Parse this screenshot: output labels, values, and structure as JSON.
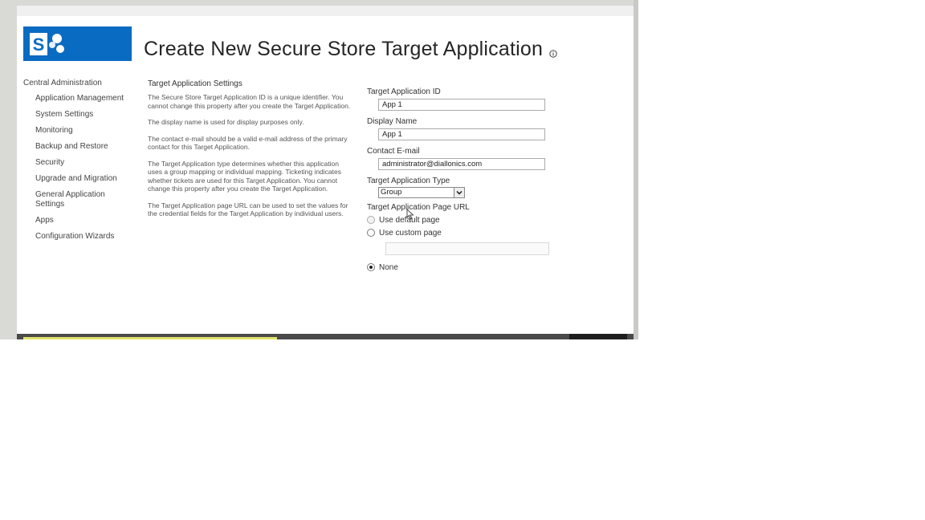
{
  "header": {
    "title": "Create New Secure Store Target Application"
  },
  "icons": {
    "logo": "sharepoint-logo",
    "info": "info-icon"
  },
  "nav": {
    "root": "Central Administration",
    "items": [
      "Application Management",
      "System Settings",
      "Monitoring",
      "Backup and Restore",
      "Security",
      "Upgrade and Migration",
      "General Application Settings",
      "Apps",
      "Configuration Wizards"
    ]
  },
  "description": {
    "section_title": "Target Application Settings",
    "paragraphs": [
      "The Secure Store Target Application ID is a unique identifier. You cannot change this property after you create the Target Application.",
      "The display name is used for display purposes only.",
      "The contact e-mail should be a valid e-mail address of the primary contact for this Target Application.",
      "The Target Application type determines whether this application uses a group mapping or individual mapping. Ticketing indicates whether tickets are used for this Target Application. You cannot change this property after you create the Target Application.",
      "The Target Application page URL can be used to set the values for the credential fields for the Target Application by individual users."
    ]
  },
  "form": {
    "app_id_label": "Target Application ID",
    "app_id_value": "App 1",
    "display_name_label": "Display Name",
    "display_name_value": "App 1",
    "contact_email_label": "Contact E-mail",
    "contact_email_value": "administrator@diallonics.com",
    "app_type_label": "Target Application Type",
    "app_type_value": "Group",
    "page_url_label": "Target Application Page URL",
    "radio_default": "Use default page",
    "radio_custom": "Use custom page",
    "radio_none": "None",
    "selected_option": "None"
  },
  "colors": {
    "logo_blue": "#0a6bc2",
    "frame_gray": "#d9dad6"
  }
}
